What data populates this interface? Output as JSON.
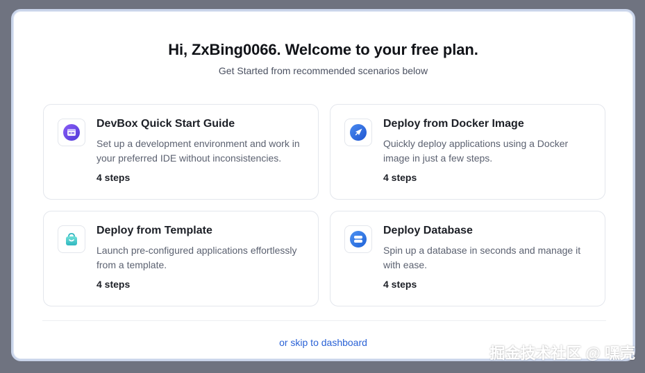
{
  "header": {
    "title": "Hi, ZxBing0066. Welcome to your free plan.",
    "subtitle": "Get Started from recommended scenarios below"
  },
  "cards": [
    {
      "title": "DevBox Quick Start Guide",
      "description": "Set up a development environment and work in your preferred IDE without inconsistencies.",
      "steps": "4 steps",
      "icon": "devbox-icon"
    },
    {
      "title": "Deploy from Docker Image",
      "description": "Quickly deploy applications using a Docker image in just a few steps.",
      "steps": "4 steps",
      "icon": "rocket-icon"
    },
    {
      "title": "Deploy from Template",
      "description": "Launch pre-configured applications effortlessly from a template.",
      "steps": "4 steps",
      "icon": "template-bag-icon"
    },
    {
      "title": "Deploy Database",
      "description": "Spin up a database in seconds and manage it with ease.",
      "steps": "4 steps",
      "icon": "database-icon"
    }
  ],
  "footer": {
    "skip_label": "or skip to dashboard"
  },
  "watermark": "掘金技术社区 @ 嘿壳",
  "colors": {
    "accent": "#2a62d6",
    "devbox": "#6d4ce8",
    "rocket": "#2f6fe4",
    "template": "#35c2c4",
    "database": "#2f7be6"
  }
}
